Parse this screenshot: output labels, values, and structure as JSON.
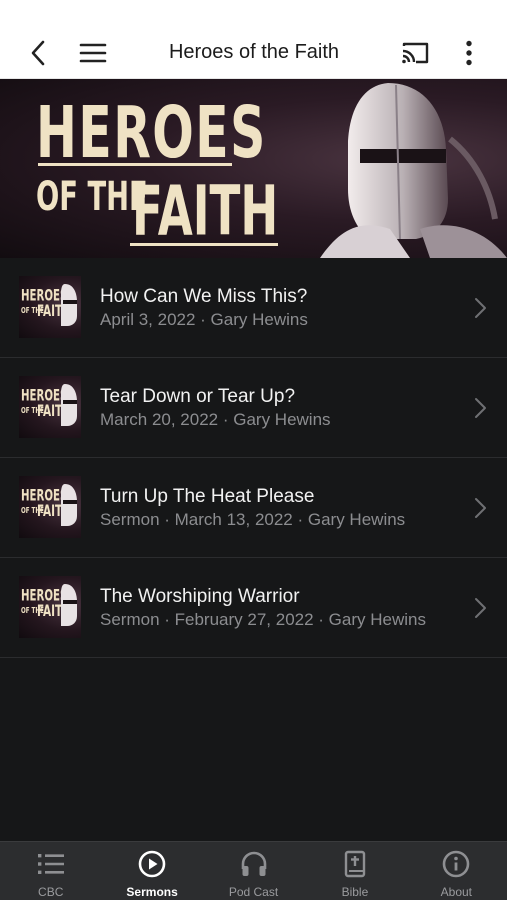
{
  "header": {
    "title": "Heroes of the Faith",
    "icons": [
      "back-arrow-icon",
      "hamburger-menu-icon",
      "cast-icon",
      "more-vertical-icon"
    ]
  },
  "banner": {
    "line1": "HEROES",
    "line2": "OF THE",
    "line3": "FAITH"
  },
  "sermons": [
    {
      "title": "How Can We Miss This?",
      "meta": "April 3, 2022 · Gary Hewins"
    },
    {
      "title": "Tear Down or Tear Up?",
      "meta": "March 20, 2022 · Gary Hewins"
    },
    {
      "title": "Turn Up The Heat Please",
      "meta": "Sermon · March 13, 2022 · Gary Hewins"
    },
    {
      "title": "The Worshiping Warrior",
      "meta": "Sermon · February 27, 2022 · Gary Hewins"
    }
  ],
  "thumbnail": {
    "line1": "HEROES",
    "line2": "OF THE",
    "line3": "FAITH"
  },
  "tabs": [
    {
      "label": "CBC",
      "icon": "list-icon",
      "active": false
    },
    {
      "label": "Sermons",
      "icon": "play-circle-icon",
      "active": true
    },
    {
      "label": "Pod Cast",
      "icon": "headphones-icon",
      "active": false
    },
    {
      "label": "Bible",
      "icon": "bible-icon",
      "active": false
    },
    {
      "label": "About",
      "icon": "info-icon",
      "active": false
    }
  ],
  "colors": {
    "background": "#161718",
    "header_bg": "#ffffff",
    "tabbar_bg": "#2c2d2f",
    "banner_text": "#efe2c4",
    "active_tab": "#ffffff",
    "inactive_tab": "#9a9b9e"
  }
}
